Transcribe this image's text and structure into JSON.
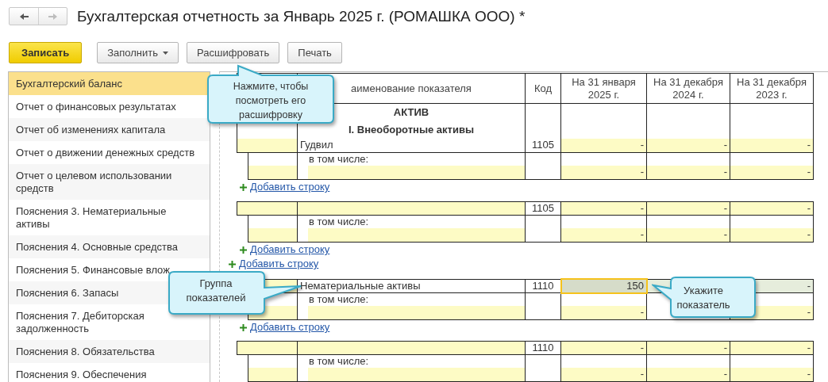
{
  "window": {
    "title": "Бухгалтерская отчетность за Январь 2025 г. (РОМАШКА ООО) *",
    "nav": [
      {
        "kind": "back",
        "disabled": false
      },
      {
        "kind": "forward",
        "disabled": true
      }
    ]
  },
  "toolbar": [
    {
      "label": "Записать",
      "kind": "primary"
    },
    {
      "label": "Заполнить",
      "kind": "dropdown"
    },
    {
      "label": "Расшифровать",
      "kind": "plain"
    },
    {
      "label": "Печать",
      "kind": "plain"
    }
  ],
  "sidebar": {
    "items": [
      {
        "label": "Бухгалтерский баланс",
        "selected": true
      },
      {
        "label": "Отчет о финансовых результатах",
        "selected": false
      },
      {
        "label": "Отчет об изменениях капитала",
        "selected": false
      },
      {
        "label": "Отчет о движении денежных средств",
        "selected": false
      },
      {
        "label": "Отчет о целевом использовании средств",
        "selected": false
      },
      {
        "label": "Пояснения 3. Нематериальные активы",
        "selected": false
      },
      {
        "label": "Пояснения 4. Основные средства",
        "selected": false
      },
      {
        "label": "Пояснения 5. Финансовые влож",
        "selected": false
      },
      {
        "label": "Пояснения 6. Запасы",
        "selected": false
      },
      {
        "label": "Пояснения 7. Дебиторская задолженность",
        "selected": false
      },
      {
        "label": "Пояснения 8. Обязательства",
        "selected": false
      },
      {
        "label": "Пояснения 9. Обеспечения",
        "selected": false
      }
    ]
  },
  "table": {
    "columns": [
      "аименование показателя",
      "Код",
      "На 31 января 2025 г.",
      "На 31 декабря 2024 г.",
      "На 31 декабря 2023 г."
    ],
    "rows": [
      {
        "kind": "heading",
        "text": "АКТИВ"
      },
      {
        "kind": "heading",
        "text": "I. Внеоборотные активы"
      },
      {
        "kind": "item",
        "name": "Гудвил",
        "code": "1105",
        "values": [
          "-",
          "-",
          "-"
        ],
        "selected": false
      },
      {
        "kind": "sub",
        "name": "в том числе:",
        "values": [
          "-",
          "-",
          "-"
        ]
      },
      {
        "kind": "add",
        "label": "Добавить строку"
      },
      {
        "kind": "item",
        "code": "1105",
        "values": [
          "-",
          "-",
          "-"
        ],
        "selected": false
      },
      {
        "kind": "sub",
        "name": "в том числе:",
        "values": [
          "-",
          "-",
          "-"
        ]
      },
      {
        "kind": "add",
        "label": "Добавить строку"
      },
      {
        "kind": "add_group",
        "label": "Добавить строку"
      },
      {
        "kind": "item",
        "name": "Нематериальные активы",
        "code": "1110",
        "values": [
          {
            "text": "150",
            "focused": true
          },
          {
            "covered": true
          },
          {
            "text": "-",
            "focused": false
          }
        ],
        "selected": true
      },
      {
        "kind": "sub",
        "name": "в том числе:",
        "values": [
          {
            "text": "-"
          },
          {
            "covered": true
          },
          {
            "text": "-"
          }
        ]
      },
      {
        "kind": "add",
        "label": "Добавить строку"
      },
      {
        "kind": "item",
        "code": "1110",
        "values": [
          "-",
          "-",
          "-"
        ],
        "selected": false
      },
      {
        "kind": "sub",
        "name": "в том числе:",
        "values": [
          "-",
          "-",
          "-"
        ]
      }
    ]
  },
  "callouts": [
    {
      "text": "Нажмите, чтобы посмотреть его расшифровку"
    },
    {
      "text": "Группа показателей"
    },
    {
      "text": "Укажите показатель"
    }
  ]
}
